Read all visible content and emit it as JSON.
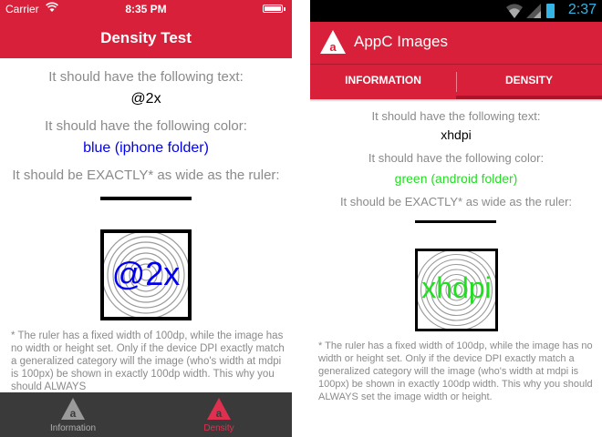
{
  "ios": {
    "status": {
      "carrier": "Carrier",
      "time": "8:35 PM"
    },
    "nav_title": "Density Test",
    "label_text": "It should have the following text:",
    "value_text": "@2x",
    "label_color": "It should have the following color:",
    "value_color": "blue (iphone folder)",
    "label_ruler": "It should be EXACTLY* as wide as the ruler:",
    "image_text": "@2x",
    "footnote": "* The ruler has a fixed width of 100dp, while the image has no width or height set. Only if the device DPI exactly match a generalized category will the image (who's width at mdpi is 100px) be shown in exactly 100dp width. This why you should ALWAYS",
    "tabs": [
      {
        "label": "Information",
        "active": false
      },
      {
        "label": "Density",
        "active": true
      }
    ],
    "colors": {
      "bar": "#d8203a",
      "blue_text": "#0000ee",
      "tabbar": "#3a3a3a"
    }
  },
  "android": {
    "status": {
      "time": "2:37"
    },
    "app_title": "AppC Images",
    "tabs": [
      {
        "label": "INFORMATION",
        "active": false
      },
      {
        "label": "DENSITY",
        "active": true
      }
    ],
    "label_text": "It should have the following text:",
    "value_text": "xhdpi",
    "label_color": "It should have the following color:",
    "value_color": "green (android folder)",
    "label_ruler": "It should be EXACTLY* as wide as the ruler:",
    "image_text": "xhdpi",
    "footnote": "* The ruler has a fixed width of 100dp, while the image has no width or height set. Only if the device DPI exactly match a generalized category will the image (who's width at mdpi is 100px) be shown in exactly 100dp width. This why you should ALWAYS set the image width or height.",
    "colors": {
      "bar": "#d8203a",
      "green_text": "#22dd22",
      "accent": "#33b5e5"
    }
  }
}
